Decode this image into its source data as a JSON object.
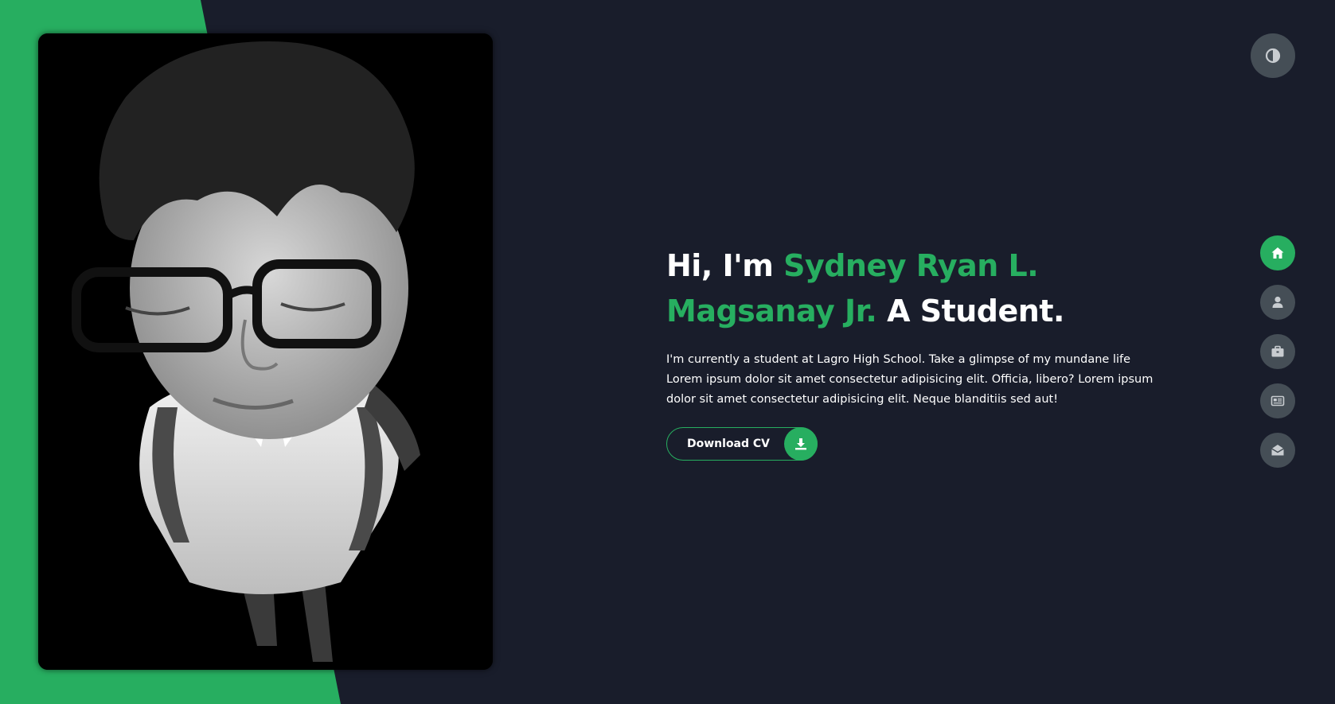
{
  "hero": {
    "greeting": "Hi, I'm ",
    "name": "Sydney Ryan L. Magsanay Jr.",
    "role": " A Student.",
    "bio": "I'm currently a student at Lagro High School. Take a glimpse of my mundane life Lorem ipsum dolor sit amet consectetur adipisicing elit. Officia, libero? Lorem ipsum dolor sit amet consectetur adipisicing elit. Neque blanditiis sed aut!",
    "cv_button": "Download CV"
  },
  "icons": {
    "theme": "contrast-icon",
    "download": "download-icon"
  },
  "nav": [
    {
      "name": "home",
      "icon": "home-icon",
      "active": true
    },
    {
      "name": "about",
      "icon": "user-icon",
      "active": false
    },
    {
      "name": "portfolio",
      "icon": "briefcase-icon",
      "active": false
    },
    {
      "name": "blogs",
      "icon": "newspaper-icon",
      "active": false
    },
    {
      "name": "contact",
      "icon": "envelope-open-icon",
      "active": false
    }
  ],
  "colors": {
    "accent": "#27ae60",
    "background": "#191d2b",
    "control": "#454e56"
  }
}
